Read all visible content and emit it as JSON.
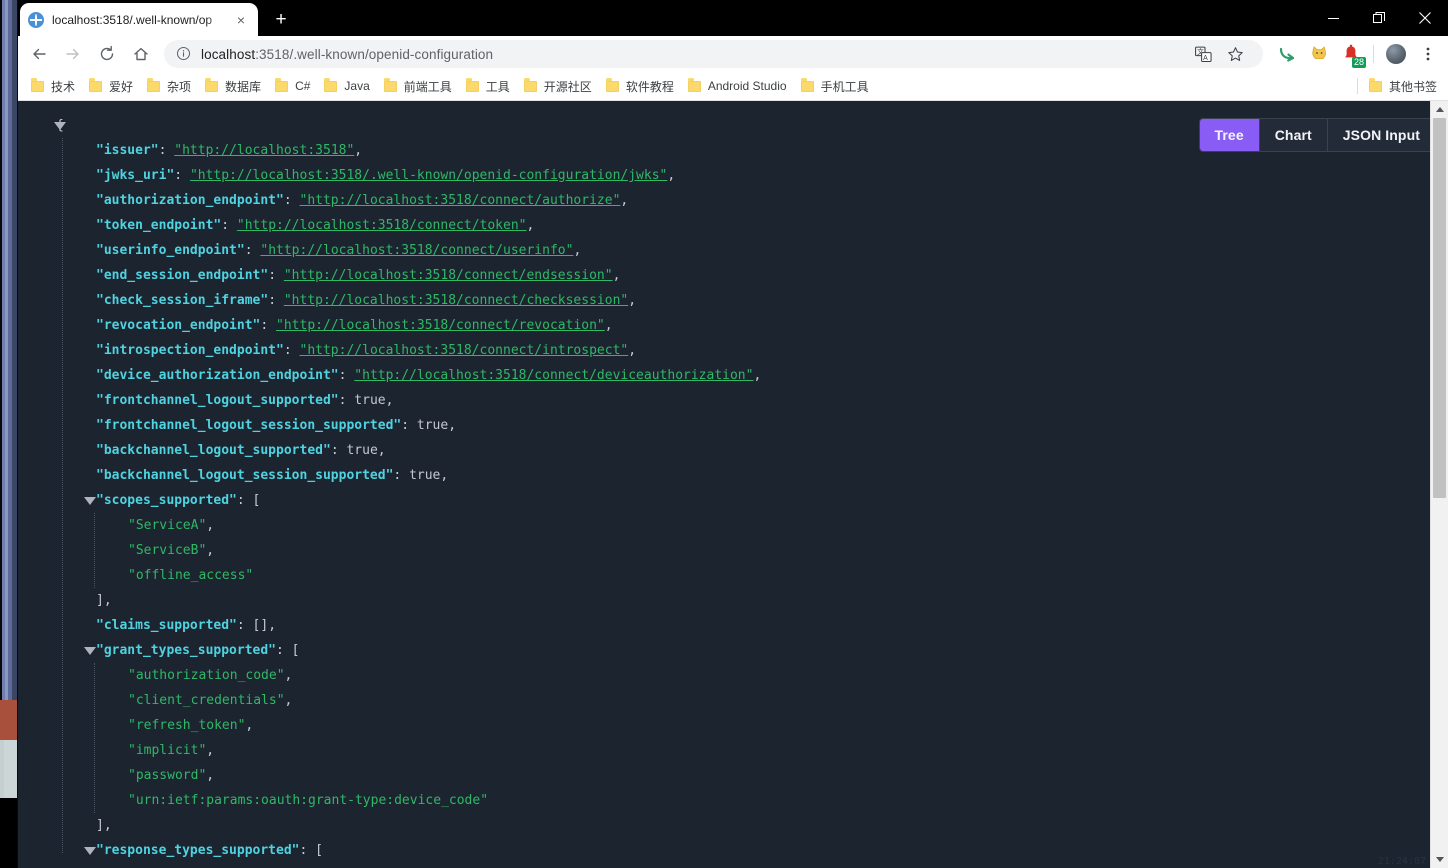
{
  "window": {
    "minimize_label": "Minimize",
    "maximize_label": "Restore",
    "close_label": "Close"
  },
  "tab": {
    "title": "localhost:3518/.well-known/op",
    "favicon": "globe-icon",
    "close_label": "×",
    "new_tab_label": "+"
  },
  "toolbar": {
    "back_label": "←",
    "forward_label": "→",
    "reload_label": "↻",
    "home_label": "⌂",
    "url_host": "localhost",
    "url_rest": ":3518/.well-known/openid-configuration",
    "url_full": "localhost:3518/.well-known/openid-configuration",
    "extension_badge": "28",
    "icons": [
      "translate-icon",
      "bookmark-star-icon",
      "extension-green-arrow-icon",
      "extension-cat-icon",
      "extension-notification-icon",
      "profile-avatar-icon",
      "chrome-menu-kebab-icon"
    ]
  },
  "bookmarks": {
    "items": [
      {
        "label": "技术"
      },
      {
        "label": "爱好"
      },
      {
        "label": "杂项"
      },
      {
        "label": "数据库"
      },
      {
        "label": "C#"
      },
      {
        "label": "Java"
      },
      {
        "label": "前端工具"
      },
      {
        "label": "工具"
      },
      {
        "label": "开源社区"
      },
      {
        "label": "软件教程"
      },
      {
        "label": "Android Studio"
      },
      {
        "label": "手机工具"
      }
    ],
    "other_label": "其他书签"
  },
  "viewer": {
    "modes": [
      {
        "label": "Tree",
        "active": true
      },
      {
        "label": "Chart",
        "active": false
      },
      {
        "label": "JSON Input",
        "active": false
      }
    ]
  },
  "json": {
    "open_brace": "{",
    "rows": [
      {
        "key": "\"issuer\"",
        "colon": ": ",
        "value": "\"http://localhost:3518\"",
        "comma": ",",
        "type": "link"
      },
      {
        "key": "\"jwks_uri\"",
        "colon": ": ",
        "value": "\"http://localhost:3518/.well-known/openid-configuration/jwks\"",
        "comma": ",",
        "type": "link"
      },
      {
        "key": "\"authorization_endpoint\"",
        "colon": ": ",
        "value": "\"http://localhost:3518/connect/authorize\"",
        "comma": ",",
        "type": "link"
      },
      {
        "key": "\"token_endpoint\"",
        "colon": ": ",
        "value": "\"http://localhost:3518/connect/token\"",
        "comma": ",",
        "type": "link"
      },
      {
        "key": "\"userinfo_endpoint\"",
        "colon": ": ",
        "value": "\"http://localhost:3518/connect/userinfo\"",
        "comma": ",",
        "type": "link"
      },
      {
        "key": "\"end_session_endpoint\"",
        "colon": ": ",
        "value": "\"http://localhost:3518/connect/endsession\"",
        "comma": ",",
        "type": "link"
      },
      {
        "key": "\"check_session_iframe\"",
        "colon": ": ",
        "value": "\"http://localhost:3518/connect/checksession\"",
        "comma": ",",
        "type": "link"
      },
      {
        "key": "\"revocation_endpoint\"",
        "colon": ": ",
        "value": "\"http://localhost:3518/connect/revocation\"",
        "comma": ",",
        "type": "link"
      },
      {
        "key": "\"introspection_endpoint\"",
        "colon": ": ",
        "value": "\"http://localhost:3518/connect/introspect\"",
        "comma": ",",
        "type": "link"
      },
      {
        "key": "\"device_authorization_endpoint\"",
        "colon": ": ",
        "value": "\"http://localhost:3518/connect/deviceauthorization\"",
        "comma": ",",
        "type": "link"
      },
      {
        "key": "\"frontchannel_logout_supported\"",
        "colon": ": ",
        "value": "true",
        "comma": ",",
        "type": "bool"
      },
      {
        "key": "\"frontchannel_logout_session_supported\"",
        "colon": ": ",
        "value": "true",
        "comma": ",",
        "type": "bool"
      },
      {
        "key": "\"backchannel_logout_supported\"",
        "colon": ": ",
        "value": "true",
        "comma": ",",
        "type": "bool"
      },
      {
        "key": "\"backchannel_logout_session_supported\"",
        "colon": ": ",
        "value": "true",
        "comma": ",",
        "type": "bool"
      }
    ],
    "scopes_key": "\"scopes_supported\"",
    "scopes_open": ": [",
    "scopes": [
      {
        "value": "\"ServiceA\"",
        "comma": ","
      },
      {
        "value": "\"ServiceB\"",
        "comma": ","
      },
      {
        "value": "\"offline_access\"",
        "comma": ""
      }
    ],
    "scopes_close": "],",
    "claims_key": "\"claims_supported\"",
    "claims_value": ": [],",
    "grant_key": "\"grant_types_supported\"",
    "grant_open": ": [",
    "grants": [
      {
        "value": "\"authorization_code\"",
        "comma": ","
      },
      {
        "value": "\"client_credentials\"",
        "comma": ","
      },
      {
        "value": "\"refresh_token\"",
        "comma": ","
      },
      {
        "value": "\"implicit\"",
        "comma": ","
      },
      {
        "value": "\"password\"",
        "comma": ","
      },
      {
        "value": "\"urn:ietf:params:oauth:grant-type:device_code\"",
        "comma": ""
      }
    ],
    "grant_close": "],",
    "response_key": "\"response_types_supported\"",
    "response_open": ": ["
  },
  "statusbar": {
    "timestamp": "21:24:07"
  },
  "colors": {
    "page_bg": "#1c2430",
    "key": "#4fd3e0",
    "string": "#2fb866",
    "accent": "#8a5cf6",
    "badge": "#0f9d58"
  }
}
